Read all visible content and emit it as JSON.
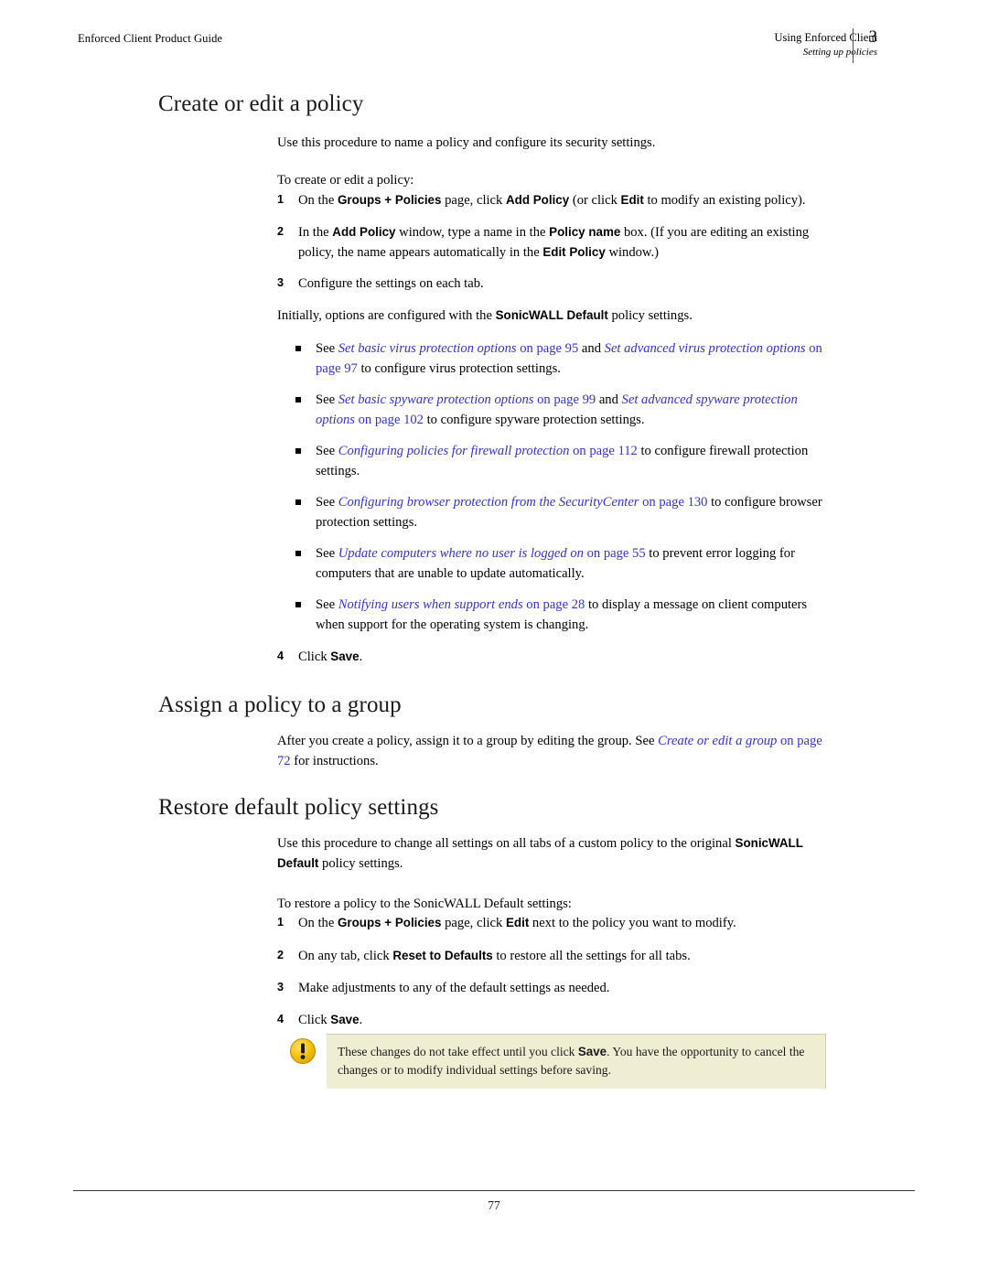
{
  "header": {
    "left_text": "Enforced Client Product Guide",
    "chapter_title": "Using Enforced Client",
    "section_title": "Setting up policies",
    "chapter_number": "3"
  },
  "footer": {
    "page_number": "77"
  },
  "sections": {
    "create_policy": {
      "heading": "Create or edit a policy",
      "intro": "Use this procedure to name a policy and configure its security settings.",
      "lead_in": "To create or edit a policy:",
      "steps": [
        {
          "num": "1",
          "text": "On the Groups + Policies page, click Add Policy (or click Edit to modify an existing policy)."
        },
        {
          "num": "2",
          "text": "In the Add Policy window, type a name in the Policy name box. (If you are editing an existing policy, the name appears automatically in the Edit Policy window.)"
        },
        {
          "num": "3",
          "text": "Configure the settings on each tab."
        },
        {
          "num": "4",
          "text": "Click Save."
        }
      ],
      "step3_note": "Initially, options are configured with the SonicWALL Default policy settings.",
      "bullets": [
        {
          "prefix": "See ",
          "link1": "Set basic virus protection options",
          "mid1": " on page 95",
          "conj": " and ",
          "link2": "Set advanced virus protection options",
          "mid2": " on page 97",
          "suffix": " to configure virus protection settings."
        },
        {
          "prefix": "See ",
          "link1": "Set basic spyware protection options",
          "mid1": " on page 99",
          "conj": " and ",
          "link2": "Set advanced spyware protection options",
          "mid2": " on page 102",
          "suffix": " to configure spyware protection settings."
        },
        {
          "prefix": "See ",
          "link1": "Configuring policies for firewall protection",
          "mid1": " on page 112",
          "conj": "",
          "link2": "",
          "mid2": "",
          "suffix": " to configure firewall protection settings."
        },
        {
          "prefix": "See ",
          "link1": "Configuring browser protection from the SecurityCenter",
          "mid1": " on page 130",
          "conj": "",
          "link2": "",
          "mid2": "",
          "suffix": " to configure browser protection settings."
        },
        {
          "prefix": "See ",
          "link1": "Update computers where no user is logged on",
          "mid1": " on page 55",
          "conj": "",
          "link2": "",
          "mid2": "",
          "suffix": " to prevent error logging for computers that are unable to update automatically."
        },
        {
          "prefix": "See ",
          "link1": "Notifying users when support ends",
          "mid1": " on page 28",
          "conj": "",
          "link2": "",
          "mid2": "",
          "suffix": " to display a message on client computers when support for the operating system is changing."
        }
      ]
    },
    "assign_policy": {
      "heading": "Assign a policy to a group",
      "body_before_link": "After you create a policy, assign it to a group by editing the group. See ",
      "link_title": "Create or edit a group",
      "link_page": " on page 72",
      "body_after_link": " for instructions."
    },
    "restore_defaults": {
      "heading": "Restore default policy settings",
      "intro_part1": "Use this procedure to change all settings on all tabs of a custom policy to the original ",
      "intro_bold1": "SonicWALL Default",
      "intro_part2": " policy settings.",
      "lead_in": "To restore a policy to the SonicWALL Default settings:",
      "steps": [
        {
          "num": "1",
          "text": "On the Groups + Policies page, click Edit next to the policy you want to modify."
        },
        {
          "num": "2",
          "text": "On any tab, click Reset to Defaults to restore all the settings for all tabs."
        },
        {
          "num": "3",
          "text": "Make adjustments to any of the default settings as needed."
        },
        {
          "num": "4",
          "text": "Click Save."
        }
      ],
      "note": {
        "icon": "warning-icon",
        "text_part1": "These changes do not take effect until you click ",
        "text_bold": "Save",
        "text_part2": ". You have the opportunity to cancel the changes or to modify individual settings before saving."
      }
    }
  },
  "colors": {
    "link": "#3333CC",
    "note_background": "#EFEED3",
    "note_border": "#CFCDB0",
    "warning_icon": "#F2C118",
    "text": "#000000"
  }
}
